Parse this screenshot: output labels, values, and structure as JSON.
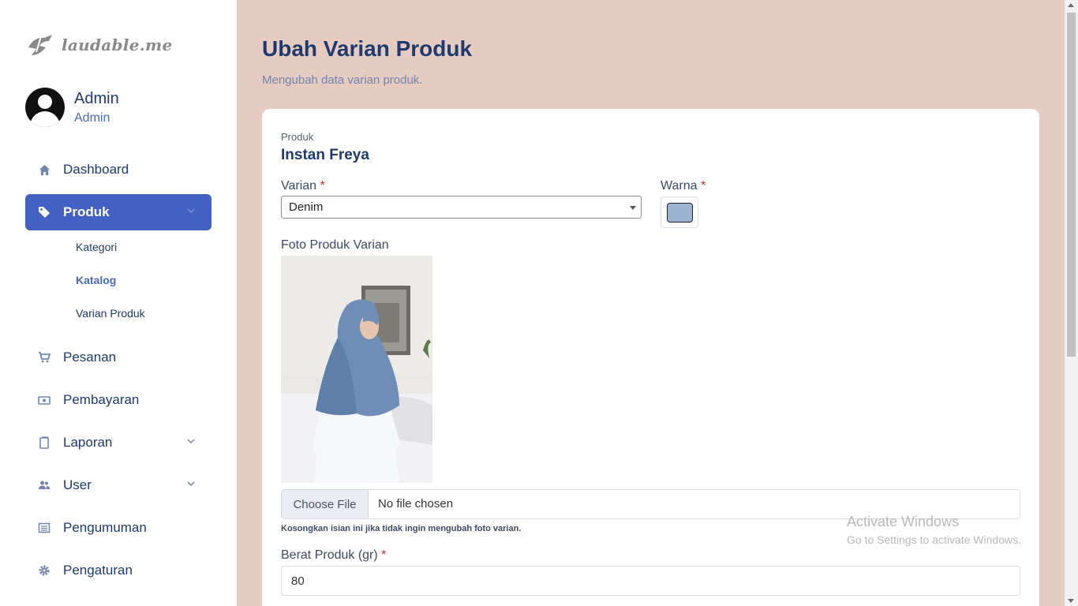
{
  "brand": {
    "logo_text": "laudable.me"
  },
  "profile": {
    "name": "Admin",
    "role": "Admin"
  },
  "sidebar": {
    "items": [
      {
        "label": "Dashboard",
        "icon": "home-icon"
      },
      {
        "label": "Produk",
        "icon": "tag-icon",
        "active": true,
        "children": [
          {
            "label": "Kategori"
          },
          {
            "label": "Katalog",
            "current": true
          },
          {
            "label": "Varian Produk"
          }
        ]
      },
      {
        "label": "Pesanan",
        "icon": "cart-icon"
      },
      {
        "label": "Pembayaran",
        "icon": "money-icon"
      },
      {
        "label": "Laporan",
        "icon": "document-icon"
      },
      {
        "label": "User",
        "icon": "users-icon"
      },
      {
        "label": "Pengumuman",
        "icon": "newspaper-icon"
      },
      {
        "label": "Pengaturan",
        "icon": "gear-icon"
      }
    ]
  },
  "page": {
    "title": "Ubah Varian Produk",
    "subtitle": "Mengubah data varian produk."
  },
  "form": {
    "product_label": "Produk",
    "product_name": "Instan Freya",
    "variant_label": "Varian",
    "variant_value": "Denim",
    "color_label": "Warna",
    "color_value": "#9bb5d1",
    "required_mark": "*",
    "photo_label": "Foto Produk Varian",
    "file_button": "Choose File",
    "file_status": "No file chosen",
    "photo_hint": "Kosongkan isian ini jika tidak ingin mengubah foto varian.",
    "weight_label": "Berat Produk (gr)",
    "weight_value": "80"
  },
  "watermark": {
    "line1": "Activate Windows",
    "line2": "Go to Settings to activate Windows."
  },
  "colors": {
    "accent": "#4361c2",
    "background": "#e6cbc0",
    "heading": "#1f3a6e"
  }
}
